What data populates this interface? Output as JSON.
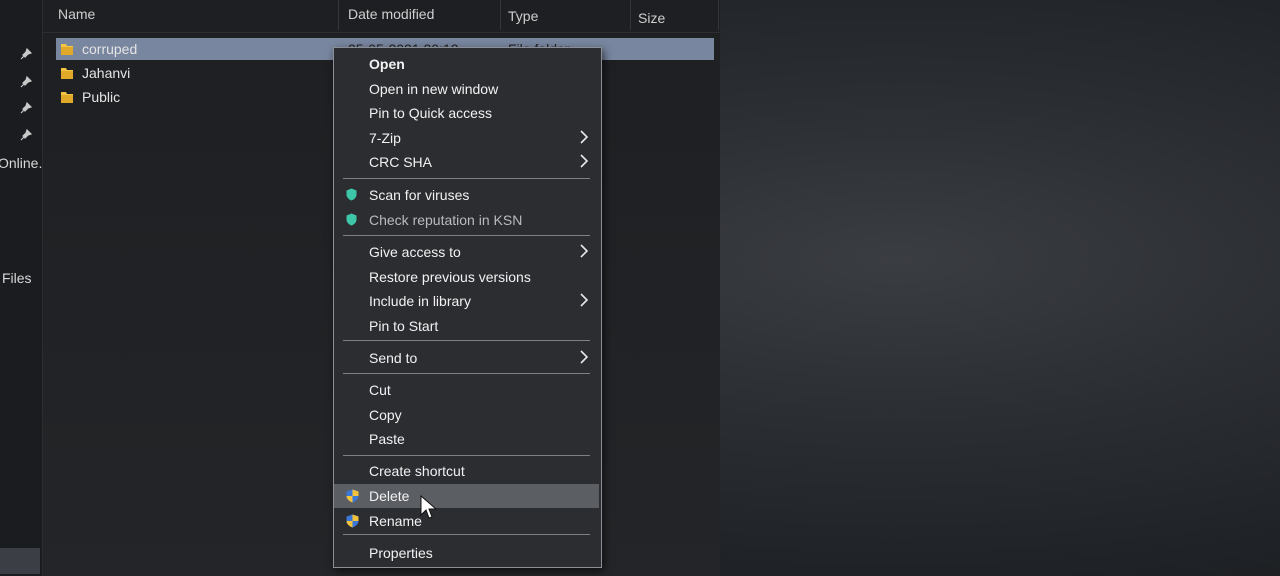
{
  "nav": {
    "labels": [
      "Online.",
      "Files"
    ]
  },
  "header": {
    "columns": [
      "Name",
      "Date modified",
      "Type",
      "Size"
    ]
  },
  "files": [
    {
      "name": "corruped",
      "date": "25-05-2021 20:12",
      "type": "File folder",
      "selected": true
    },
    {
      "name": "Jahanvi",
      "selected": false
    },
    {
      "name": "Public",
      "selected": false
    }
  ],
  "context_menu": {
    "items": [
      {
        "label": "Open",
        "bold": true
      },
      {
        "label": "Open in new window"
      },
      {
        "label": "Pin to Quick access"
      },
      {
        "label": "7-Zip",
        "submenu": true
      },
      {
        "label": "CRC SHA",
        "submenu": true
      },
      {
        "label": "Scan for viruses",
        "icon": "kaspersky-shield-icon"
      },
      {
        "label": "Check reputation in KSN",
        "icon": "kaspersky-shield-icon",
        "dim": true
      },
      {
        "label": "Give access to",
        "submenu": true
      },
      {
        "label": "Restore previous versions"
      },
      {
        "label": "Include in library",
        "submenu": true
      },
      {
        "label": "Pin to Start"
      },
      {
        "label": "Send to",
        "submenu": true
      },
      {
        "label": "Cut"
      },
      {
        "label": "Copy"
      },
      {
        "label": "Paste"
      },
      {
        "label": "Create shortcut"
      },
      {
        "label": "Delete",
        "icon": "uac-shield-icon",
        "hover": true
      },
      {
        "label": "Rename",
        "icon": "uac-shield-icon"
      },
      {
        "label": "Properties"
      }
    ]
  },
  "colors": {
    "selection": "#78869f",
    "folder": "#f4c542",
    "menu_bg": "#2c2d31",
    "menu_hover": "#5b5e63",
    "kaspersky": "#3ec6a8"
  }
}
